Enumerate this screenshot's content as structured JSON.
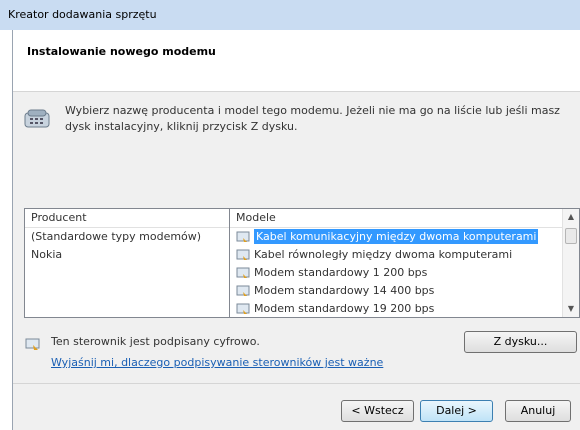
{
  "window": {
    "title": "Kreator dodawania sprzętu"
  },
  "header": {
    "title": "Instalowanie nowego modemu"
  },
  "intro": {
    "text": "Wybierz nazwę producenta i model tego modemu. Jeżeli nie ma go na liście lub jeśli masz dysk instalacyjny, kliknij przycisk Z dysku."
  },
  "icons": {
    "intro": "modem-phone-icon",
    "driver": "signed-driver-icon"
  },
  "manufacturers": {
    "header": "Producent",
    "items": [
      "(Standardowe typy modemów)",
      "Nokia"
    ],
    "selected_index": 0
  },
  "models": {
    "header": "Modele",
    "items": [
      "Kabel komunikacyjny między dwoma komputerami",
      "Kabel równoległy między dwoma komputerami",
      "Modem standardowy 1 200 bps",
      "Modem standardowy 14 400 bps",
      "Modem standardowy 19 200 bps"
    ],
    "selected_index": 0
  },
  "driver": {
    "signed_text": "Ten sterownik jest podpisany cyfrowo.",
    "link_text": "Wyjaśnij mi, dlaczego podpisywanie sterowników jest ważne"
  },
  "buttons": {
    "have_disk": "Z dysku...",
    "back": "< Wstecz",
    "next": "Dalej >",
    "cancel": "Anuluj"
  },
  "colors": {
    "selection": "#3399ff",
    "link": "#1a5fb4",
    "titlebar": "#c9dcf2"
  }
}
